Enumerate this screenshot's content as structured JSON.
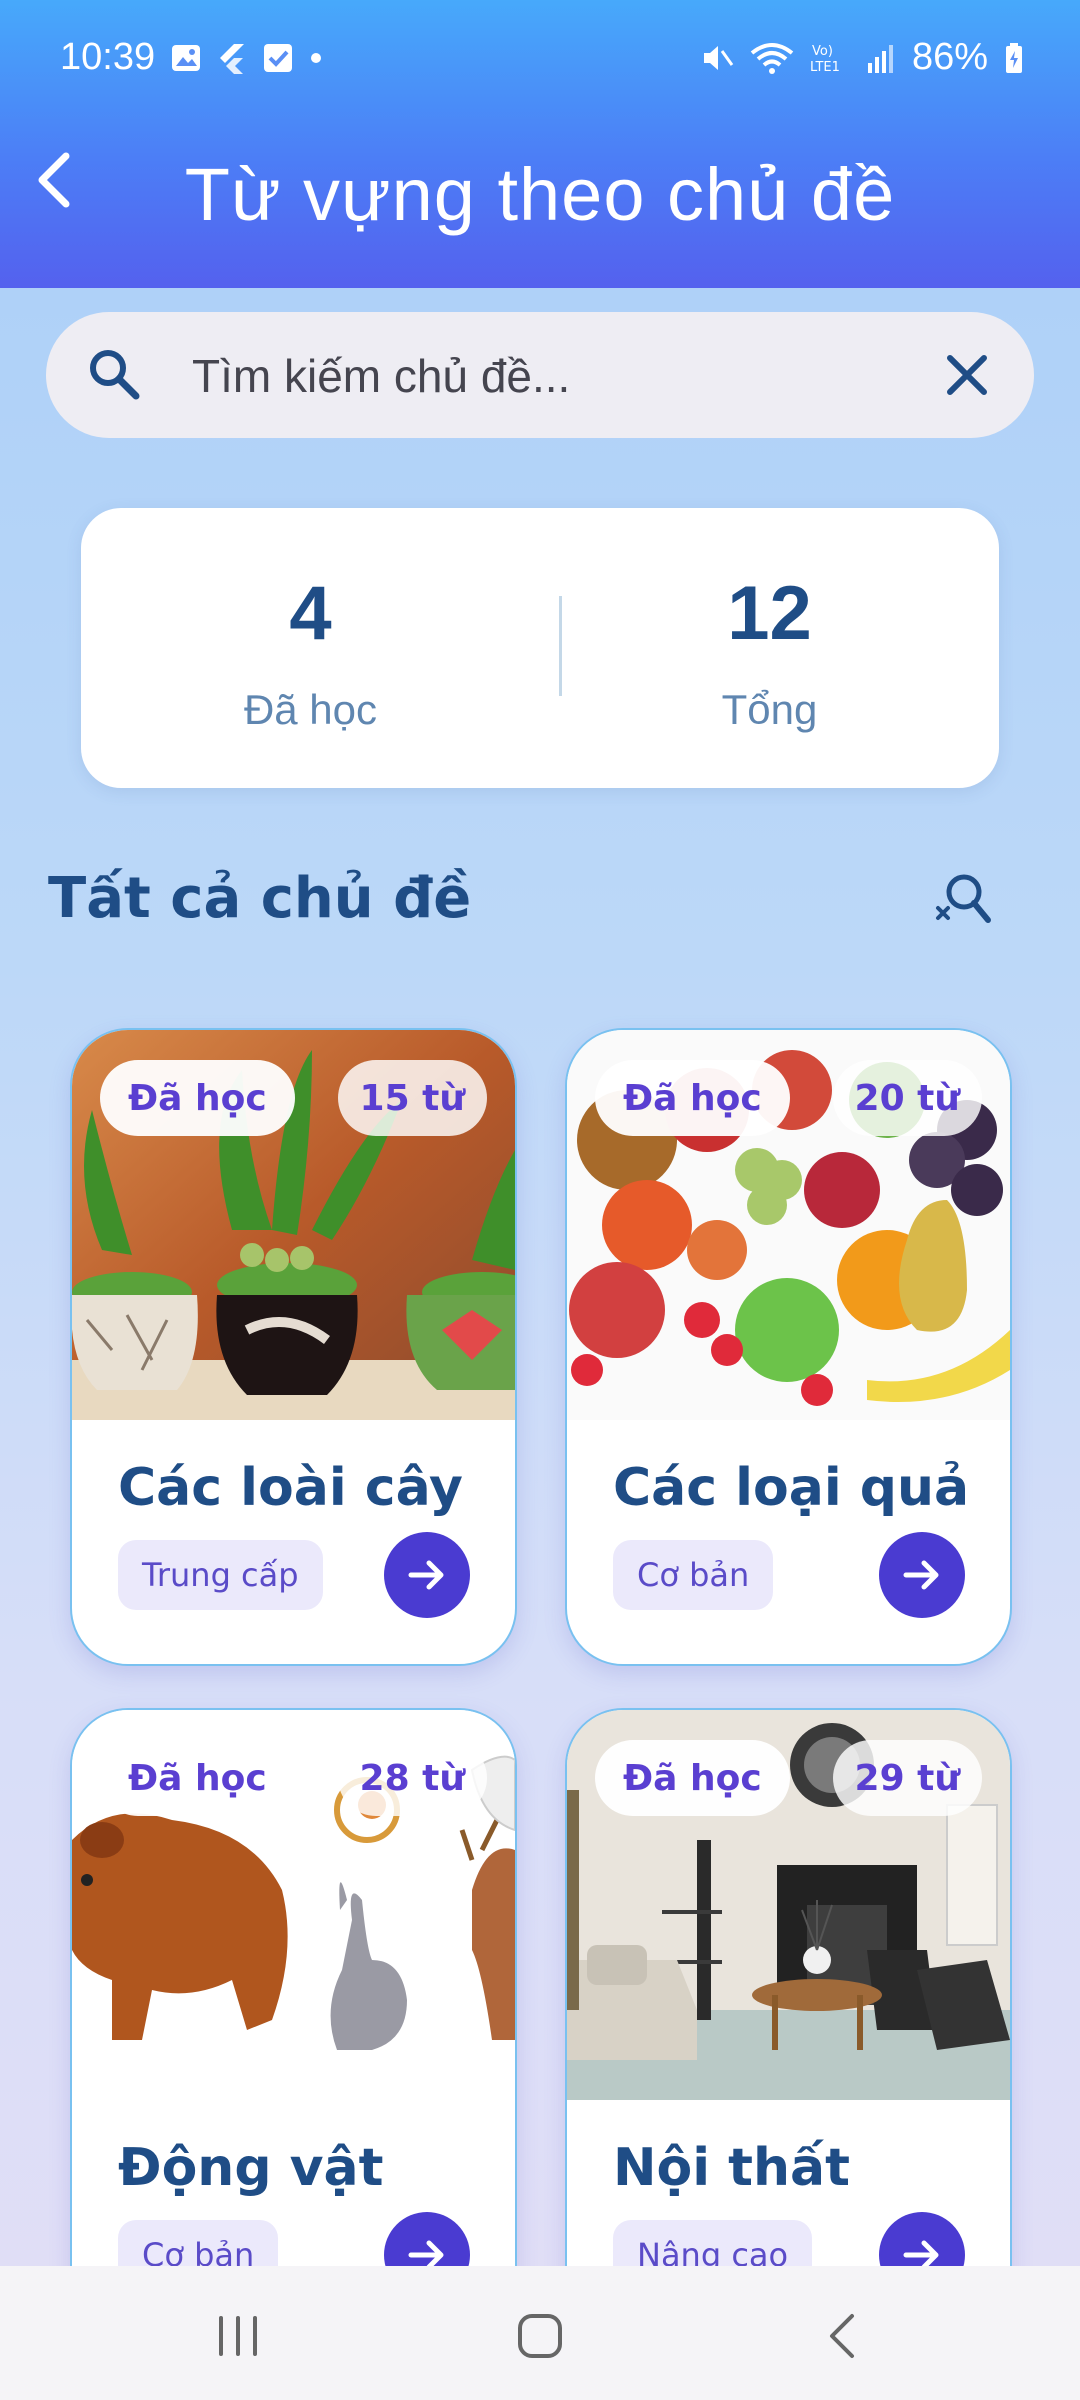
{
  "status_bar": {
    "time": "10:39",
    "battery": "86%"
  },
  "header": {
    "title": "Từ vựng theo chủ đề"
  },
  "search": {
    "placeholder": "Tìm kiếm chủ đề..."
  },
  "stats": {
    "learned_value": "4",
    "learned_label": "Đã học",
    "total_value": "12",
    "total_label": "Tổng"
  },
  "section": {
    "title": "Tất cả chủ đề"
  },
  "cards": [
    {
      "badge": "Đã học",
      "count": "15 từ",
      "title": "Các loài cây",
      "level": "Trung cấp",
      "image_icon": "potted-plants-image"
    },
    {
      "badge": "Đã học",
      "count": "20 từ",
      "title": "Các loại quả",
      "level": "Cơ bản",
      "image_icon": "fruits-image"
    },
    {
      "badge": "Đã học",
      "count": "28 từ",
      "title": "Động vật",
      "level": "Cơ bản",
      "image_icon": "animals-image"
    },
    {
      "badge": "Đã học",
      "count": "29 từ",
      "title": "Nội thất",
      "level": "Nâng cao",
      "image_icon": "living-room-image"
    }
  ],
  "colors": {
    "accent": "#4a3bd1",
    "title_blue": "#1f4d86",
    "header_top": "#47a9fb",
    "header_bottom": "#5461ee"
  }
}
